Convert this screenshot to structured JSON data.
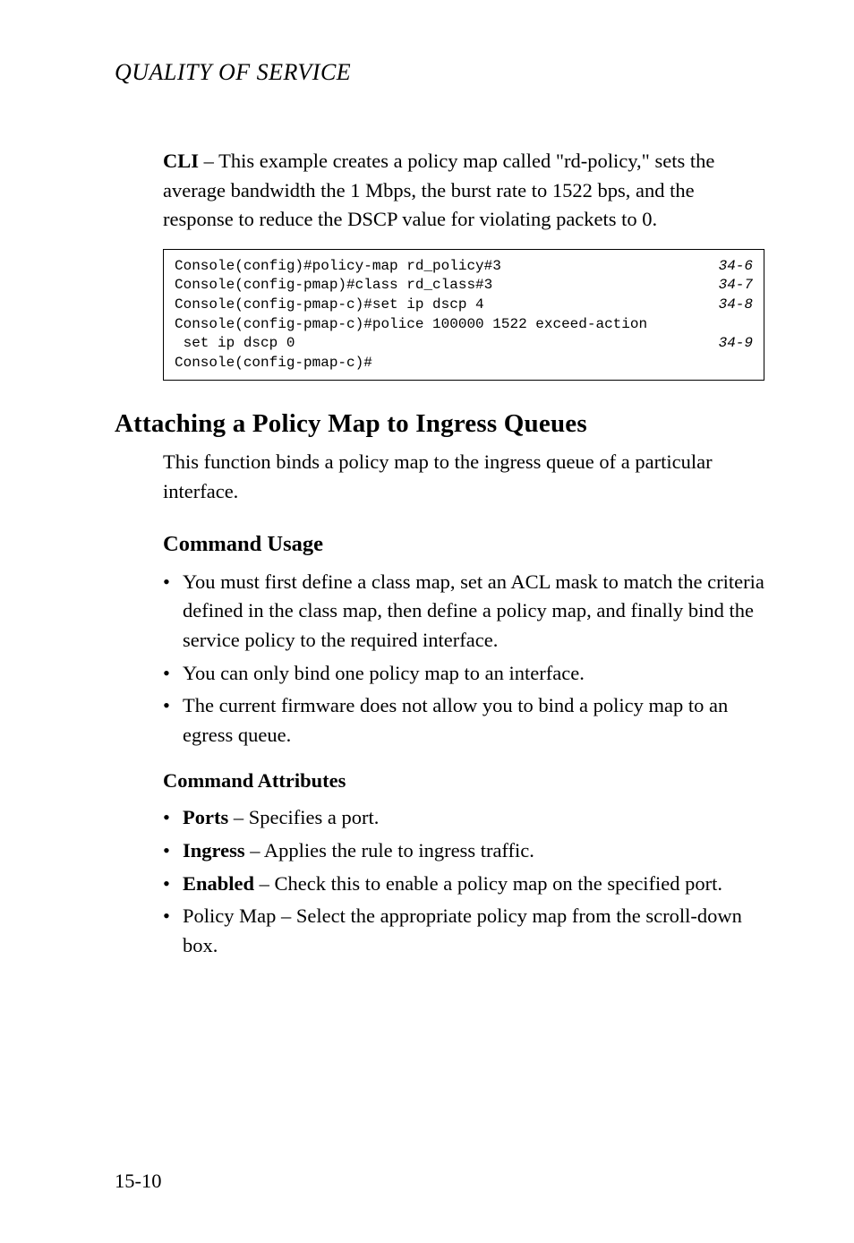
{
  "running_head": "QUALITY OF SERVICE",
  "intro_para": {
    "lead": "CLI",
    "rest": " – This example creates a policy map called \"rd-policy,\" sets the average bandwidth the 1 Mbps, the burst rate to 1522 bps, and the response to reduce the DSCP value for violating packets to 0."
  },
  "code": {
    "lines": [
      {
        "text": "Console(config)#policy-map rd_policy#3",
        "ref": "34-6"
      },
      {
        "text": "Console(config-pmap)#class rd_class#3",
        "ref": "34-7"
      },
      {
        "text": "Console(config-pmap-c)#set ip dscp 4",
        "ref": "34-8"
      },
      {
        "text": "Console(config-pmap-c)#police 100000 1522 exceed-action",
        "ref": ""
      },
      {
        "text": " set ip dscp 0",
        "ref": "34-9"
      },
      {
        "text": "Console(config-pmap-c)#",
        "ref": ""
      }
    ]
  },
  "section_title": "Attaching a Policy Map to Ingress Queues",
  "section_intro": "This function binds a policy map to the ingress queue of a particular interface.",
  "usage_heading": "Command Usage",
  "usage_items": [
    "You must first define a class map, set an ACL mask to match the criteria defined in the class map, then define a policy map, and finally bind the service policy to the required interface.",
    "You can only bind one policy map to an interface.",
    "The current firmware does not allow you to bind a policy map to an egress queue."
  ],
  "attrs_heading": "Command Attributes",
  "attrs_items": [
    {
      "term": "Ports",
      "desc": " – Specifies a port."
    },
    {
      "term": "Ingress",
      "desc": " – Applies the rule to ingress traffic."
    },
    {
      "term": "Enabled",
      "desc": " – Check this to enable a policy map on the specified port."
    },
    {
      "term": "",
      "desc": "Policy Map – Select the appropriate policy map from the scroll-down box."
    }
  ],
  "page_number": "15-10"
}
